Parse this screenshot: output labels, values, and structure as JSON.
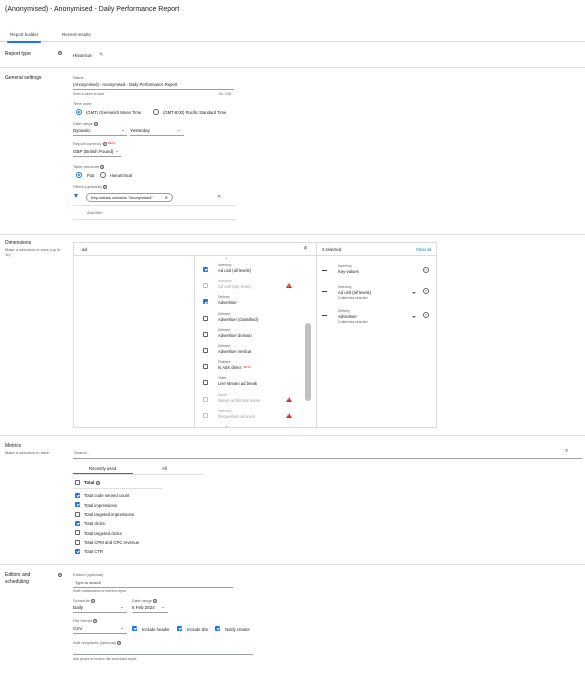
{
  "page": {
    "title": "(Anonymised) - Anonymised - Daily Performance Report"
  },
  "tabs": [
    {
      "label": "Report builder",
      "active": true
    },
    {
      "label": "Recent results",
      "active": false
    }
  ],
  "report_type": {
    "label": "Report type",
    "value": "Historical"
  },
  "general": {
    "label": "General settings",
    "name_label": "Name",
    "name_value": "(Anonymised) - Anonymised - Daily Performance Report",
    "name_hint": "Enter a name to save",
    "name_counter": "50 / 128",
    "timezone_label": "Time zone",
    "tz_options": [
      "(GMT) Greenwich Mean Time",
      "(GMT-8:00) Pacific Standard Time"
    ],
    "date_range_label": "Date range",
    "date_range_value": "Dynamic",
    "date_range_period": "Yesterday",
    "currency_label": "Report currency",
    "currency_badge": "BETA",
    "currency_value": "GBP (British Pound)",
    "table_structure_label": "Table structure",
    "structure_options": [
      "Flat",
      "Hierarchical"
    ],
    "filters_label": "Filters (optional)",
    "filter_chip": "Key-values contains \"Anonymised\"",
    "add_filter": "Add filter"
  },
  "dimensions": {
    "label": "Dimensions",
    "sublabel": "Make a selection to save (up to 10)",
    "search_value": "ad",
    "selected_count": "3 selected",
    "clear_all": "Clear all",
    "list": [
      {
        "cat": "Inventory",
        "name": "Ad unit (all levels)",
        "checked": true,
        "disabled": false,
        "warn": false
      },
      {
        "cat": "Inventory",
        "name": "Ad unit (top level)",
        "checked": false,
        "disabled": true,
        "warn": true
      },
      {
        "cat": "Delivery",
        "name": "Advertiser",
        "checked": true,
        "disabled": false,
        "warn": false
      },
      {
        "cat": "Delivery",
        "name": "Advertiser (classified)",
        "checked": false,
        "disabled": false,
        "warn": false
      },
      {
        "cat": "Delivery",
        "name": "Advertiser domain",
        "checked": false,
        "disabled": false,
        "warn": false
      },
      {
        "cat": "Delivery",
        "name": "Advertiser vertical",
        "checked": false,
        "disabled": false,
        "warn": false
      },
      {
        "cat": "Platform",
        "name": "Is AdX direct",
        "checked": false,
        "disabled": false,
        "warn": false,
        "badge": "BETA"
      },
      {
        "cat": "Video",
        "name": "Live stream ad break",
        "checked": false,
        "disabled": false,
        "warn": false
      },
      {
        "cat": "Native",
        "name": "Native ad format name",
        "checked": false,
        "disabled": true,
        "warn": true
      },
      {
        "cat": "Inventory",
        "name": "Requested ad sizes",
        "checked": false,
        "disabled": true,
        "warn": true
      }
    ],
    "selected": [
      {
        "cat": "Inventory",
        "name": "Key-values",
        "sub": ""
      },
      {
        "cat": "Inventory",
        "name": "Ad unit (all levels)",
        "sub": "0 attributes selected"
      },
      {
        "cat": "Delivery",
        "name": "Advertiser",
        "sub": "0 attributes selected"
      }
    ]
  },
  "metrics": {
    "label": "Metrics",
    "sublabel": "Make a selection to save",
    "search_placeholder": "Search...",
    "tabs": [
      "Recently used",
      "All"
    ],
    "total_label": "Total",
    "items": [
      {
        "name": "Total code served count",
        "checked": true
      },
      {
        "name": "Total impressions",
        "checked": true
      },
      {
        "name": "Total targeted impressions",
        "checked": false
      },
      {
        "name": "Total clicks",
        "checked": true
      },
      {
        "name": "Total targeted clicks",
        "checked": false
      },
      {
        "name": "Total CPM and CPC revenue",
        "checked": false
      },
      {
        "name": "Total CTR",
        "checked": true
      }
    ]
  },
  "editors": {
    "label": "Editors and scheduling",
    "editors_label": "Editors (optional)",
    "editors_placeholder": "Type to search",
    "editors_hint": "Invite collaborators to edit this report",
    "schedule_label": "Schedule",
    "schedule_value": "Daily",
    "start_label": "Date range",
    "start_value": "6 Feb 2024",
    "file_format_label": "File format",
    "file_format_value": "CSV",
    "options": [
      {
        "name": "Include header",
        "checked": true
      },
      {
        "name": "Include IDs",
        "checked": true
      },
      {
        "name": "Notify creator",
        "checked": true
      }
    ],
    "recipients_label": "Add recipients (optional)",
    "recipients_hint": "Add people to receive this scheduled report"
  }
}
